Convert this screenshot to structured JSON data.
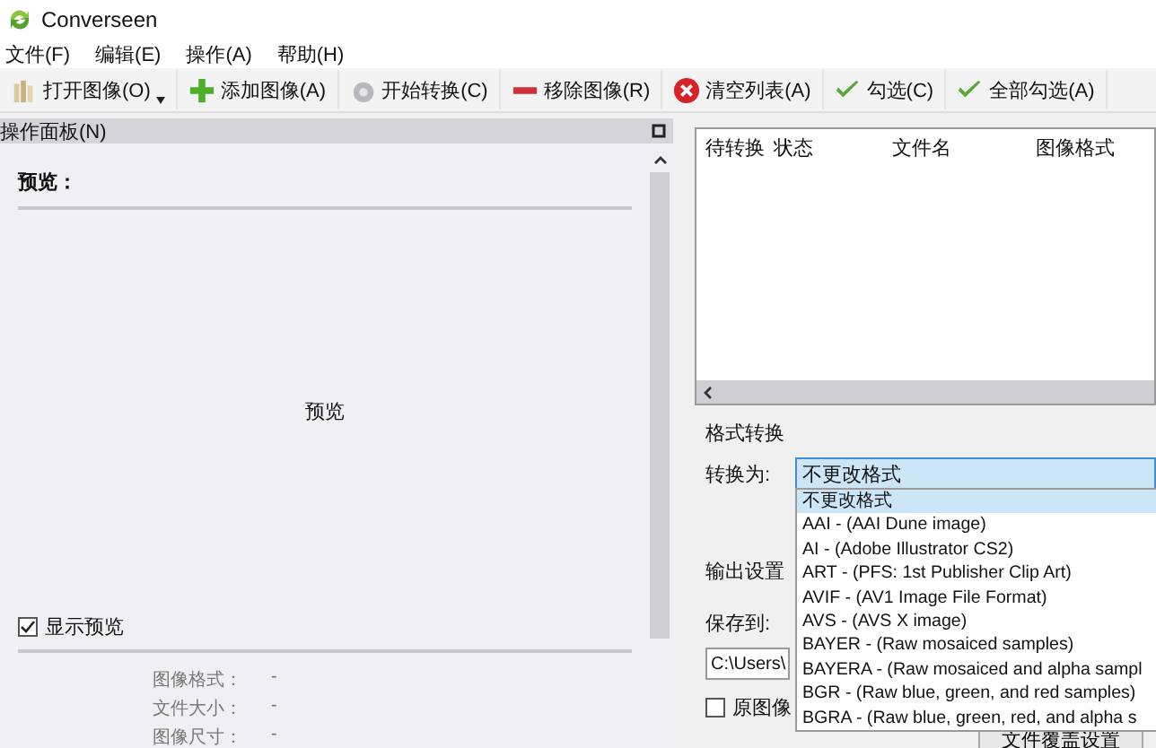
{
  "window": {
    "title": "Converseen"
  },
  "menu": [
    "文件(F)",
    "编辑(E)",
    "操作(A)",
    "帮助(H)"
  ],
  "toolbar": [
    {
      "label": "打开图像(O)",
      "kind": "open",
      "dropdown": true
    },
    {
      "label": "添加图像(A)",
      "kind": "add",
      "dropdown": false
    },
    {
      "label": "开始转换(C)",
      "kind": "convert",
      "dropdown": false
    },
    {
      "label": "移除图像(R)",
      "kind": "remove",
      "dropdown": false
    },
    {
      "label": "清空列表(A)",
      "kind": "clear",
      "dropdown": false
    },
    {
      "label": "勾选(C)",
      "kind": "check",
      "dropdown": false
    },
    {
      "label": "全部勾选(A)",
      "kind": "check",
      "dropdown": false
    }
  ],
  "panel": {
    "title": "操作面板(N)",
    "preview_heading": "预览：",
    "preview_text": "预览",
    "show_preview": {
      "label": "显示预览",
      "checked": true
    },
    "info": [
      {
        "label": "图像格式：",
        "value": "-"
      },
      {
        "label": "文件大小：",
        "value": "-"
      },
      {
        "label": "图像尺寸：",
        "value": "-"
      }
    ]
  },
  "file_list": {
    "columns": [
      "待转换",
      "状态",
      "文件名",
      "图像格式"
    ]
  },
  "format": {
    "title": "格式转换",
    "convert_label": "转换为:",
    "value": "不更改格式",
    "options": [
      {
        "label": "不更改格式",
        "selected": true
      },
      {
        "label": "AAI - (AAI Dune image)",
        "selected": false
      },
      {
        "label": "AI - (Adobe Illustrator CS2)",
        "selected": false
      },
      {
        "label": "ART - (PFS: 1st Publisher Clip Art)",
        "selected": false
      },
      {
        "label": "AVIF - (AV1 Image File Format)",
        "selected": false
      },
      {
        "label": "AVS - (AVS X image)",
        "selected": false
      },
      {
        "label": "BAYER - (Raw mosaiced samples)",
        "selected": false
      },
      {
        "label": "BAYERA - (Raw mosaiced and alpha sampl",
        "selected": false
      },
      {
        "label": "BGR - (Raw blue, green, and red samples)",
        "selected": false
      },
      {
        "label": "BGRA - (Raw blue, green, red, and alpha s",
        "selected": false
      }
    ]
  },
  "output": {
    "title": "输出设置",
    "save_label": "保存到:",
    "path": "C:\\Users\\",
    "keep_original": {
      "label": "原图像",
      "checked": false
    },
    "button": "文件覆盖设置"
  }
}
